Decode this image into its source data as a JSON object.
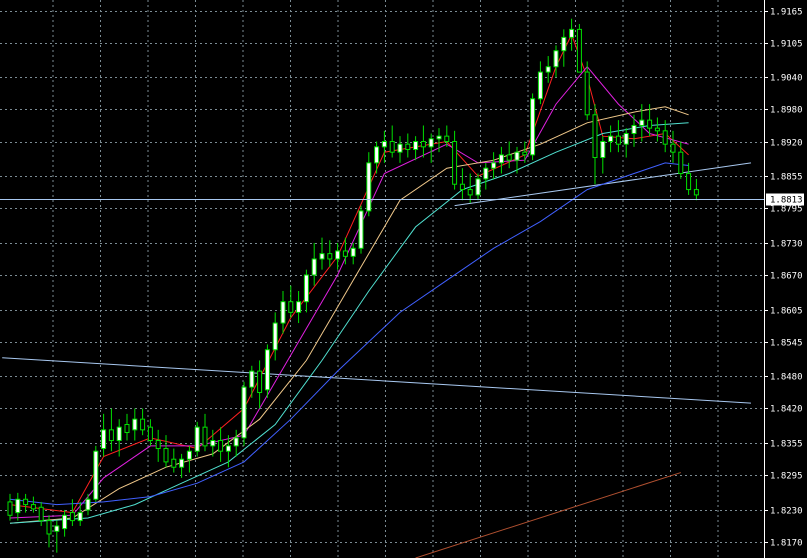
{
  "chart_data": {
    "type": "candlestick",
    "title": "",
    "xlabel": "",
    "ylabel": "",
    "ylim": [
      1.814,
      1.9185
    ],
    "y_ticks": [
      "1.9165",
      "1.9105",
      "1.9040",
      "1.8980",
      "1.8920",
      "1.8855",
      "1.8795",
      "1.8730",
      "1.8670",
      "1.8605",
      "1.8545",
      "1.8480",
      "1.8420",
      "1.8355",
      "1.8295",
      "1.8230",
      "1.8170"
    ],
    "current_price": "1.8813",
    "grid": true,
    "colors": {
      "background": "#000000",
      "grid": "#7c8c94",
      "bull_body": "#ffffff",
      "bear_body": "#000000",
      "candle_outline": "#00e000",
      "ma_red": "#ff2020",
      "ma_magenta": "#e020e0",
      "ma_tan": "#f0c88a",
      "ma_cyan": "#50e0d0",
      "ma_blue": "#4060ff",
      "trendline_light": "#a8c8f0",
      "trendline_brown": "#b05030",
      "axis_text": "#ffffff",
      "price_tag_bg": "#ffffff",
      "price_tag_text": "#000000"
    },
    "candles": [
      [
        1.8245,
        1.826,
        1.821,
        1.822
      ],
      [
        1.8225,
        1.8262,
        1.821,
        1.825
      ],
      [
        1.825,
        1.826,
        1.8225,
        1.824
      ],
      [
        1.824,
        1.8255,
        1.8225,
        1.8232
      ],
      [
        1.8235,
        1.8245,
        1.82,
        1.821
      ],
      [
        1.821,
        1.822,
        1.816,
        1.8185
      ],
      [
        1.819,
        1.821,
        1.815,
        1.82
      ],
      [
        1.8195,
        1.823,
        1.818,
        1.822
      ],
      [
        1.8225,
        1.825,
        1.82,
        1.821
      ],
      [
        1.821,
        1.8245,
        1.82,
        1.8225
      ],
      [
        1.823,
        1.826,
        1.822,
        1.825
      ],
      [
        1.825,
        1.835,
        1.8245,
        1.834
      ],
      [
        1.8345,
        1.841,
        1.833,
        1.838
      ],
      [
        1.838,
        1.842,
        1.834,
        1.836
      ],
      [
        1.836,
        1.84,
        1.833,
        1.8385
      ],
      [
        1.839,
        1.841,
        1.836,
        1.8375
      ],
      [
        1.838,
        1.842,
        1.836,
        1.84
      ],
      [
        1.84,
        1.842,
        1.837,
        1.838
      ],
      [
        1.8385,
        1.84,
        1.835,
        1.836
      ],
      [
        1.836,
        1.838,
        1.832,
        1.8345
      ],
      [
        1.8345,
        1.837,
        1.831,
        1.832
      ],
      [
        1.8325,
        1.8345,
        1.83,
        1.831
      ],
      [
        1.831,
        1.8335,
        1.829,
        1.8325
      ],
      [
        1.8325,
        1.835,
        1.83,
        1.834
      ],
      [
        1.834,
        1.8395,
        1.833,
        1.8385
      ],
      [
        1.8385,
        1.841,
        1.834,
        1.835
      ],
      [
        1.835,
        1.838,
        1.833,
        1.836
      ],
      [
        1.836,
        1.8385,
        1.832,
        1.834
      ],
      [
        1.834,
        1.837,
        1.831,
        1.835
      ],
      [
        1.835,
        1.838,
        1.833,
        1.8365
      ],
      [
        1.8365,
        1.847,
        1.835,
        1.846
      ],
      [
        1.846,
        1.85,
        1.844,
        1.849
      ],
      [
        1.849,
        1.851,
        1.842,
        1.845
      ],
      [
        1.8455,
        1.854,
        1.844,
        1.853
      ],
      [
        1.853,
        1.86,
        1.851,
        1.858
      ],
      [
        1.858,
        1.864,
        1.856,
        1.862
      ],
      [
        1.862,
        1.865,
        1.859,
        1.86
      ],
      [
        1.86,
        1.864,
        1.858,
        1.862
      ],
      [
        1.862,
        1.868,
        1.86,
        1.867
      ],
      [
        1.867,
        1.873,
        1.865,
        1.87
      ],
      [
        1.87,
        1.874,
        1.868,
        1.871
      ],
      [
        1.871,
        1.8735,
        1.8685,
        1.87
      ],
      [
        1.87,
        1.873,
        1.868,
        1.8715
      ],
      [
        1.8715,
        1.874,
        1.869,
        1.8705
      ],
      [
        1.8705,
        1.873,
        1.869,
        1.872
      ],
      [
        1.872,
        1.88,
        1.871,
        1.879
      ],
      [
        1.879,
        1.89,
        1.878,
        1.888
      ],
      [
        1.888,
        1.892,
        1.886,
        1.891
      ],
      [
        1.891,
        1.894,
        1.888,
        1.892
      ],
      [
        1.892,
        1.895,
        1.889,
        1.89
      ],
      [
        1.89,
        1.893,
        1.888,
        1.8915
      ],
      [
        1.8915,
        1.8935,
        1.889,
        1.8905
      ],
      [
        1.8905,
        1.893,
        1.8885,
        1.892
      ],
      [
        1.892,
        1.895,
        1.889,
        1.891
      ],
      [
        1.891,
        1.8935,
        1.888,
        1.8925
      ],
      [
        1.8925,
        1.8945,
        1.89,
        1.893
      ],
      [
        1.893,
        1.895,
        1.891,
        1.892
      ],
      [
        1.892,
        1.894,
        1.883,
        1.884
      ],
      [
        1.884,
        1.887,
        1.881,
        1.883
      ],
      [
        1.883,
        1.886,
        1.8805,
        1.882
      ],
      [
        1.882,
        1.886,
        1.881,
        1.885
      ],
      [
        1.885,
        1.888,
        1.883,
        1.887
      ],
      [
        1.887,
        1.89,
        1.885,
        1.888
      ],
      [
        1.888,
        1.891,
        1.886,
        1.8895
      ],
      [
        1.8895,
        1.892,
        1.887,
        1.8885
      ],
      [
        1.8885,
        1.891,
        1.886,
        1.89
      ],
      [
        1.89,
        1.892,
        1.888,
        1.8895
      ],
      [
        1.8895,
        1.901,
        1.8885,
        1.9
      ],
      [
        1.9,
        1.907,
        1.899,
        1.905
      ],
      [
        1.905,
        1.908,
        1.903,
        1.906
      ],
      [
        1.906,
        1.91,
        1.904,
        1.909
      ],
      [
        1.909,
        1.913,
        1.906,
        1.9115
      ],
      [
        1.9115,
        1.915,
        1.909,
        1.913
      ],
      [
        1.913,
        1.914,
        1.908,
        1.905
      ],
      [
        1.905,
        1.907,
        1.896,
        1.897
      ],
      [
        1.897,
        1.899,
        1.884,
        1.889
      ],
      [
        1.889,
        1.893,
        1.886,
        1.892
      ],
      [
        1.892,
        1.895,
        1.89,
        1.893
      ],
      [
        1.893,
        1.896,
        1.89,
        1.8915
      ],
      [
        1.8915,
        1.8945,
        1.889,
        1.8935
      ],
      [
        1.8935,
        1.897,
        1.891,
        1.895
      ],
      [
        1.895,
        1.899,
        1.892,
        1.896
      ],
      [
        1.896,
        1.899,
        1.893,
        1.8945
      ],
      [
        1.8945,
        1.8965,
        1.892,
        1.894
      ],
      [
        1.894,
        1.896,
        1.89,
        1.8915
      ],
      [
        1.8915,
        1.894,
        1.888,
        1.89
      ],
      [
        1.89,
        1.892,
        1.885,
        1.886
      ],
      [
        1.886,
        1.888,
        1.882,
        1.883
      ],
      [
        1.883,
        1.885,
        1.881,
        1.882
      ]
    ],
    "moving_averages": [
      {
        "color": "#ff2020",
        "points": [
          [
            0,
            1.824
          ],
          [
            8,
            1.8225
          ],
          [
            12,
            1.833
          ],
          [
            18,
            1.8365
          ],
          [
            24,
            1.8345
          ],
          [
            30,
            1.842
          ],
          [
            36,
            1.859
          ],
          [
            42,
            1.8705
          ],
          [
            48,
            1.89
          ],
          [
            56,
            1.892
          ],
          [
            60,
            1.8855
          ],
          [
            66,
            1.8895
          ],
          [
            70,
            1.906
          ],
          [
            72,
            1.912
          ],
          [
            74,
            1.904
          ],
          [
            76,
            1.893
          ],
          [
            80,
            1.8925
          ],
          [
            84,
            1.8935
          ],
          [
            87,
            1.8895
          ]
        ]
      },
      {
        "color": "#e020e0",
        "points": [
          [
            0,
            1.8215
          ],
          [
            8,
            1.822
          ],
          [
            12,
            1.829
          ],
          [
            18,
            1.835
          ],
          [
            24,
            1.835
          ],
          [
            30,
            1.837
          ],
          [
            36,
            1.852
          ],
          [
            42,
            1.867
          ],
          [
            48,
            1.886
          ],
          [
            56,
            1.8915
          ],
          [
            60,
            1.888
          ],
          [
            66,
            1.8885
          ],
          [
            70,
            1.899
          ],
          [
            74,
            1.906
          ],
          [
            78,
            1.899
          ],
          [
            82,
            1.8935
          ],
          [
            87,
            1.8915
          ]
        ]
      },
      {
        "color": "#f0c88a",
        "points": [
          [
            0,
            1.8205
          ],
          [
            8,
            1.8215
          ],
          [
            14,
            1.827
          ],
          [
            20,
            1.831
          ],
          [
            26,
            1.8335
          ],
          [
            32,
            1.84
          ],
          [
            38,
            1.851
          ],
          [
            44,
            1.866
          ],
          [
            50,
            1.881
          ],
          [
            56,
            1.887
          ],
          [
            62,
            1.8885
          ],
          [
            68,
            1.8915
          ],
          [
            74,
            1.8955
          ],
          [
            80,
            1.8975
          ],
          [
            84,
            1.8985
          ],
          [
            87,
            1.897
          ]
        ]
      },
      {
        "color": "#50e0d0",
        "points": [
          [
            0,
            1.8205
          ],
          [
            10,
            1.8215
          ],
          [
            16,
            1.824
          ],
          [
            22,
            1.828
          ],
          [
            28,
            1.832
          ],
          [
            34,
            1.839
          ],
          [
            40,
            1.851
          ],
          [
            46,
            1.864
          ],
          [
            52,
            1.876
          ],
          [
            58,
            1.883
          ],
          [
            64,
            1.886
          ],
          [
            70,
            1.89
          ],
          [
            76,
            1.8935
          ],
          [
            82,
            1.895
          ],
          [
            87,
            1.8955
          ]
        ]
      },
      {
        "color": "#4060ff",
        "points": [
          [
            0,
            1.825
          ],
          [
            6,
            1.824
          ],
          [
            12,
            1.8245
          ],
          [
            18,
            1.8255
          ],
          [
            24,
            1.828
          ],
          [
            30,
            1.832
          ],
          [
            36,
            1.84
          ],
          [
            42,
            1.849
          ],
          [
            50,
            1.86
          ],
          [
            56,
            1.866
          ],
          [
            62,
            1.872
          ],
          [
            68,
            1.877
          ],
          [
            74,
            1.883
          ],
          [
            80,
            1.886
          ],
          [
            84,
            1.888
          ],
          [
            87,
            1.8875
          ]
        ]
      }
    ],
    "trendlines": [
      {
        "color": "#a8c8f0",
        "from": [
          -1,
          1.8515
        ],
        "to": [
          95,
          1.843
        ]
      },
      {
        "color": "#a8c8f0",
        "from": [
          57,
          1.88
        ],
        "to": [
          95,
          1.888
        ]
      },
      {
        "color": "#b05030",
        "from": [
          52,
          1.814
        ],
        "to": [
          86,
          1.83
        ]
      }
    ]
  }
}
